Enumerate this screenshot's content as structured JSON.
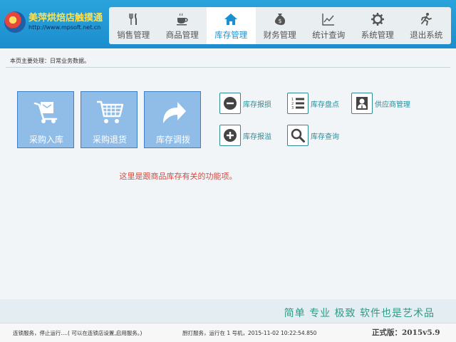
{
  "brand": {
    "title": "美萍烘焙店触摸通",
    "url": "http://www.mpsoft.net.cn"
  },
  "nav": [
    {
      "label": "销售管理",
      "icon": "fork-knife-icon"
    },
    {
      "label": "商品管理",
      "icon": "coffee-cup-icon"
    },
    {
      "label": "库存管理",
      "icon": "house-icon",
      "active": true
    },
    {
      "label": "财务管理",
      "icon": "money-bag-icon"
    },
    {
      "label": "统计查询",
      "icon": "line-chart-icon"
    },
    {
      "label": "系统管理",
      "icon": "gear-icon"
    },
    {
      "label": "退出系统",
      "icon": "running-man-icon"
    }
  ],
  "page_info": "本页主要处理：日常业务数据。",
  "main_buttons": [
    {
      "label": "采购入库",
      "icon": "hand-truck-icon"
    },
    {
      "label": "采购退货",
      "icon": "shopping-cart-icon"
    },
    {
      "label": "库存调拨",
      "icon": "curved-arrow-icon"
    }
  ],
  "quick_buttons": [
    {
      "label": "库存报损",
      "icon": "minus-circle-icon"
    },
    {
      "label": "库存盘点",
      "icon": "numbered-list-icon"
    },
    {
      "label": "供应商管理",
      "icon": "person-icon"
    },
    {
      "label": "库存报溢",
      "icon": "plus-circle-icon"
    },
    {
      "label": "库存查询",
      "icon": "magnifier-icon"
    }
  ],
  "hint": "这里是跟商品库存有关的功能项。",
  "slogan": "简单  专业  极致  软件也是艺术品",
  "status": {
    "left": "连锁服务，停止运行....( 可以在连锁店设置,启用服务。)",
    "middle": "厨打服务，运行在 1 号机，2015-11-02 10:22:54.850",
    "version": "正式版：2015v5.9"
  },
  "colors": {
    "header": "#1b8ecd",
    "tile": "#8fbde8",
    "tile_border": "#3e7fc4",
    "accent_teal": "#2a8f99",
    "hint_red": "#d9493b",
    "slogan_green": "#2f9a86"
  }
}
